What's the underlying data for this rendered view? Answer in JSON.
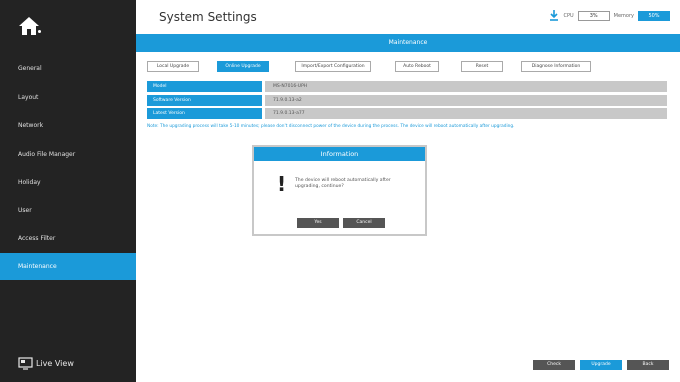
{
  "sidebar": {
    "items": [
      {
        "label": "General"
      },
      {
        "label": "Layout"
      },
      {
        "label": "Network"
      },
      {
        "label": "Audio File Manager"
      },
      {
        "label": "Holiday"
      },
      {
        "label": "User"
      },
      {
        "label": "Access Filter"
      },
      {
        "label": "Maintenance"
      }
    ],
    "live_view": "Live View"
  },
  "header": {
    "title": "System Settings",
    "cpu_label": "CPU",
    "cpu_value": "3%",
    "memory_label": "Memory",
    "memory_value": "50%"
  },
  "section_bar": "Maintenance",
  "tabs": [
    {
      "label": "Local Upgrade"
    },
    {
      "label": "Online Upgrade"
    },
    {
      "label": "Import/Export Configuration"
    },
    {
      "label": "Auto Reboot"
    },
    {
      "label": "Reset"
    },
    {
      "label": "Diagnose Information"
    }
  ],
  "info_rows": [
    {
      "label": "Model",
      "value": "MS-N7016-UPH"
    },
    {
      "label": "Software Version",
      "value": "71.9.0.13-a2"
    },
    {
      "label": "Latest Version",
      "value": "71.9.0.13-a77"
    }
  ],
  "note": "Note: The upgrading process will take 5-10 minutes; please don't disconnect power of the device during the process. The device will reboot automatically after upgrading.",
  "dialog": {
    "title": "Information",
    "icon": "!",
    "message": "The device will reboot automatically after upgrading, continue?",
    "yes": "Yes",
    "cancel": "Cancel"
  },
  "footer": {
    "check": "Check",
    "upgrade": "Upgrade",
    "back": "Back"
  },
  "colors": {
    "accent": "#1b9ad9",
    "sidebar_bg": "#232323"
  }
}
